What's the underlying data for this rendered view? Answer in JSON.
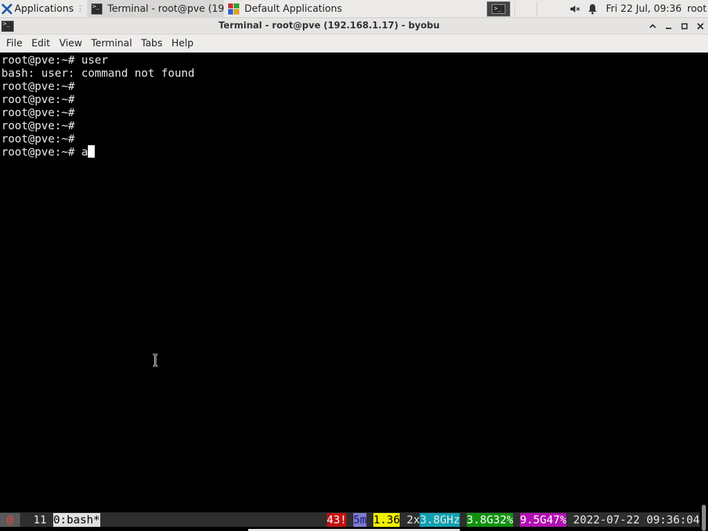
{
  "panel": {
    "apps_label": "Applications",
    "tasks": [
      {
        "label": "Terminal - root@pve (19...",
        "icon": "terminal-icon",
        "active": true
      },
      {
        "label": "Default Applications",
        "icon": "default-applications-icon",
        "active": false
      }
    ],
    "clock": "Fri 22 Jul, 09:36",
    "user": "root"
  },
  "window": {
    "title": "Terminal - root@pve (192.168.1.17) - byobu"
  },
  "menubar": [
    "File",
    "Edit",
    "View",
    "Terminal",
    "Tabs",
    "Help"
  ],
  "terminal": {
    "lines": [
      "root@pve:~# user",
      "bash: user: command not found",
      "root@pve:~#",
      "root@pve:~#",
      "root@pve:~#",
      "root@pve:~#",
      "root@pve:~#",
      "root@pve:~# a"
    ]
  },
  "byobu": {
    "segments": [
      {
        "text": " @ ",
        "fg": "#ff4040",
        "bg": "#5a5a5a"
      },
      {
        "text": "  11 ",
        "fg": "#e8e8e8",
        "bg": "#2e2e2e"
      },
      {
        "text": "0:bash*",
        "fg": "#000000",
        "bg": "#e0e0e0"
      },
      {
        "spacer": true
      },
      {
        "text": "43!",
        "fg": "#ffffff",
        "bg": "#c01010"
      },
      {
        "text": " ",
        "fg": "#e8e8e8",
        "bg": "#2e2e2e"
      },
      {
        "text": "5m",
        "fg": "#1a1a6a",
        "bg": "#7c7cd0"
      },
      {
        "text": " ",
        "fg": "#e8e8e8",
        "bg": "#2e2e2e"
      },
      {
        "text": "1.36",
        "fg": "#000000",
        "bg": "#f0f000"
      },
      {
        "text": " 2x",
        "fg": "#e8e8e8",
        "bg": "#2e2e2e"
      },
      {
        "text": "3.8GHz",
        "fg": "#e8e8e8",
        "bg": "#10a0b0"
      },
      {
        "text": " ",
        "fg": "#e8e8e8",
        "bg": "#2e2e2e"
      },
      {
        "text": "3.8G32%",
        "fg": "#ffffff",
        "bg": "#109010"
      },
      {
        "text": " ",
        "fg": "#e8e8e8",
        "bg": "#2e2e2e"
      },
      {
        "text": "9.5G47%",
        "fg": "#ffffff",
        "bg": "#b010b0"
      },
      {
        "text": " 2022-07-22 09:36:04",
        "fg": "#e8e8e8",
        "bg": "#2e2e2e"
      }
    ]
  }
}
